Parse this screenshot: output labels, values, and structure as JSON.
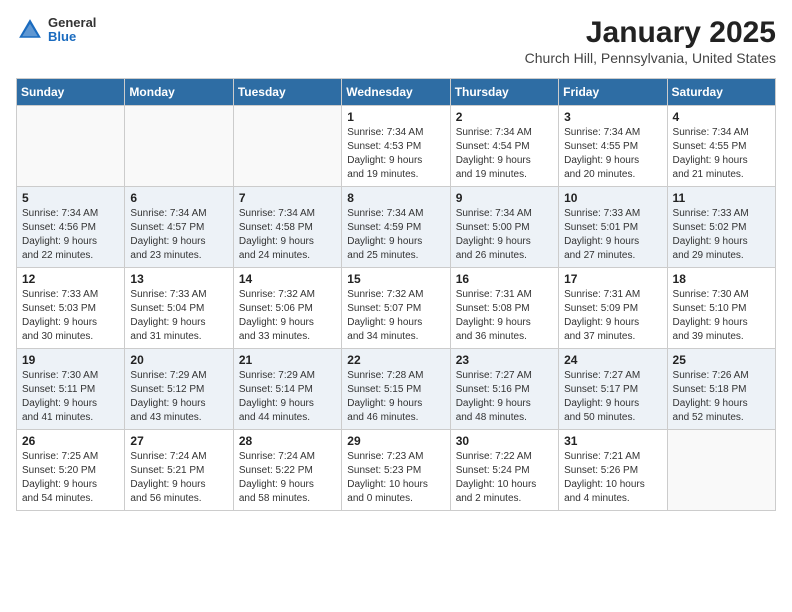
{
  "header": {
    "logo_general": "General",
    "logo_blue": "Blue",
    "title": "January 2025",
    "subtitle": "Church Hill, Pennsylvania, United States"
  },
  "days_of_week": [
    "Sunday",
    "Monday",
    "Tuesday",
    "Wednesday",
    "Thursday",
    "Friday",
    "Saturday"
  ],
  "weeks": [
    [
      {
        "day": "",
        "info": ""
      },
      {
        "day": "",
        "info": ""
      },
      {
        "day": "",
        "info": ""
      },
      {
        "day": "1",
        "info": "Sunrise: 7:34 AM\nSunset: 4:53 PM\nDaylight: 9 hours\nand 19 minutes."
      },
      {
        "day": "2",
        "info": "Sunrise: 7:34 AM\nSunset: 4:54 PM\nDaylight: 9 hours\nand 19 minutes."
      },
      {
        "day": "3",
        "info": "Sunrise: 7:34 AM\nSunset: 4:55 PM\nDaylight: 9 hours\nand 20 minutes."
      },
      {
        "day": "4",
        "info": "Sunrise: 7:34 AM\nSunset: 4:55 PM\nDaylight: 9 hours\nand 21 minutes."
      }
    ],
    [
      {
        "day": "5",
        "info": "Sunrise: 7:34 AM\nSunset: 4:56 PM\nDaylight: 9 hours\nand 22 minutes."
      },
      {
        "day": "6",
        "info": "Sunrise: 7:34 AM\nSunset: 4:57 PM\nDaylight: 9 hours\nand 23 minutes."
      },
      {
        "day": "7",
        "info": "Sunrise: 7:34 AM\nSunset: 4:58 PM\nDaylight: 9 hours\nand 24 minutes."
      },
      {
        "day": "8",
        "info": "Sunrise: 7:34 AM\nSunset: 4:59 PM\nDaylight: 9 hours\nand 25 minutes."
      },
      {
        "day": "9",
        "info": "Sunrise: 7:34 AM\nSunset: 5:00 PM\nDaylight: 9 hours\nand 26 minutes."
      },
      {
        "day": "10",
        "info": "Sunrise: 7:33 AM\nSunset: 5:01 PM\nDaylight: 9 hours\nand 27 minutes."
      },
      {
        "day": "11",
        "info": "Sunrise: 7:33 AM\nSunset: 5:02 PM\nDaylight: 9 hours\nand 29 minutes."
      }
    ],
    [
      {
        "day": "12",
        "info": "Sunrise: 7:33 AM\nSunset: 5:03 PM\nDaylight: 9 hours\nand 30 minutes."
      },
      {
        "day": "13",
        "info": "Sunrise: 7:33 AM\nSunset: 5:04 PM\nDaylight: 9 hours\nand 31 minutes."
      },
      {
        "day": "14",
        "info": "Sunrise: 7:32 AM\nSunset: 5:06 PM\nDaylight: 9 hours\nand 33 minutes."
      },
      {
        "day": "15",
        "info": "Sunrise: 7:32 AM\nSunset: 5:07 PM\nDaylight: 9 hours\nand 34 minutes."
      },
      {
        "day": "16",
        "info": "Sunrise: 7:31 AM\nSunset: 5:08 PM\nDaylight: 9 hours\nand 36 minutes."
      },
      {
        "day": "17",
        "info": "Sunrise: 7:31 AM\nSunset: 5:09 PM\nDaylight: 9 hours\nand 37 minutes."
      },
      {
        "day": "18",
        "info": "Sunrise: 7:30 AM\nSunset: 5:10 PM\nDaylight: 9 hours\nand 39 minutes."
      }
    ],
    [
      {
        "day": "19",
        "info": "Sunrise: 7:30 AM\nSunset: 5:11 PM\nDaylight: 9 hours\nand 41 minutes."
      },
      {
        "day": "20",
        "info": "Sunrise: 7:29 AM\nSunset: 5:12 PM\nDaylight: 9 hours\nand 43 minutes."
      },
      {
        "day": "21",
        "info": "Sunrise: 7:29 AM\nSunset: 5:14 PM\nDaylight: 9 hours\nand 44 minutes."
      },
      {
        "day": "22",
        "info": "Sunrise: 7:28 AM\nSunset: 5:15 PM\nDaylight: 9 hours\nand 46 minutes."
      },
      {
        "day": "23",
        "info": "Sunrise: 7:27 AM\nSunset: 5:16 PM\nDaylight: 9 hours\nand 48 minutes."
      },
      {
        "day": "24",
        "info": "Sunrise: 7:27 AM\nSunset: 5:17 PM\nDaylight: 9 hours\nand 50 minutes."
      },
      {
        "day": "25",
        "info": "Sunrise: 7:26 AM\nSunset: 5:18 PM\nDaylight: 9 hours\nand 52 minutes."
      }
    ],
    [
      {
        "day": "26",
        "info": "Sunrise: 7:25 AM\nSunset: 5:20 PM\nDaylight: 9 hours\nand 54 minutes."
      },
      {
        "day": "27",
        "info": "Sunrise: 7:24 AM\nSunset: 5:21 PM\nDaylight: 9 hours\nand 56 minutes."
      },
      {
        "day": "28",
        "info": "Sunrise: 7:24 AM\nSunset: 5:22 PM\nDaylight: 9 hours\nand 58 minutes."
      },
      {
        "day": "29",
        "info": "Sunrise: 7:23 AM\nSunset: 5:23 PM\nDaylight: 10 hours\nand 0 minutes."
      },
      {
        "day": "30",
        "info": "Sunrise: 7:22 AM\nSunset: 5:24 PM\nDaylight: 10 hours\nand 2 minutes."
      },
      {
        "day": "31",
        "info": "Sunrise: 7:21 AM\nSunset: 5:26 PM\nDaylight: 10 hours\nand 4 minutes."
      },
      {
        "day": "",
        "info": ""
      }
    ]
  ]
}
